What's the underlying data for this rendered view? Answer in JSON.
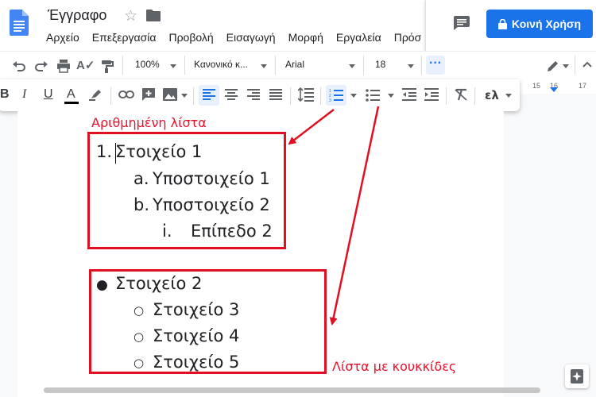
{
  "header": {
    "title": "Έγγραφο",
    "menu": [
      "Αρχείο",
      "Επεξεργασία",
      "Προβολή",
      "Εισαγωγή",
      "Μορφή",
      "Εργαλεία",
      "Πρόσ"
    ],
    "share_label": "Κοινή Χρήση"
  },
  "toolbar": {
    "zoom": "100%",
    "style": "Κανονικό κ...",
    "font": "Arial",
    "size": "18",
    "input_tools": "ελ",
    "ruler": [
      "15",
      "16",
      "17"
    ]
  },
  "annotations": {
    "numbered_caption": "Αριθμημένη λίστα",
    "bullet_caption": "Λίστα με κουκκίδες",
    "color": "#e01020"
  },
  "numbered_list": [
    {
      "marker": "1.",
      "text": "Στοιχείο 1"
    },
    {
      "marker": "a.",
      "text": "Υποστοιχείο 1"
    },
    {
      "marker": "b.",
      "text": "Υποστοιχείο 2"
    },
    {
      "marker": "i.",
      "text": "Επίπεδο 2"
    }
  ],
  "bullet_list": [
    {
      "marker": "●",
      "text": "Στοιχείο 2"
    },
    {
      "marker": "○",
      "text": "Στοιχείο 3"
    },
    {
      "marker": "○",
      "text": "Στοιχείο 4"
    },
    {
      "marker": "○",
      "text": "Στοιχείο 5"
    }
  ],
  "colors": {
    "accent": "#1a73e8",
    "annotation": "#e01020"
  }
}
